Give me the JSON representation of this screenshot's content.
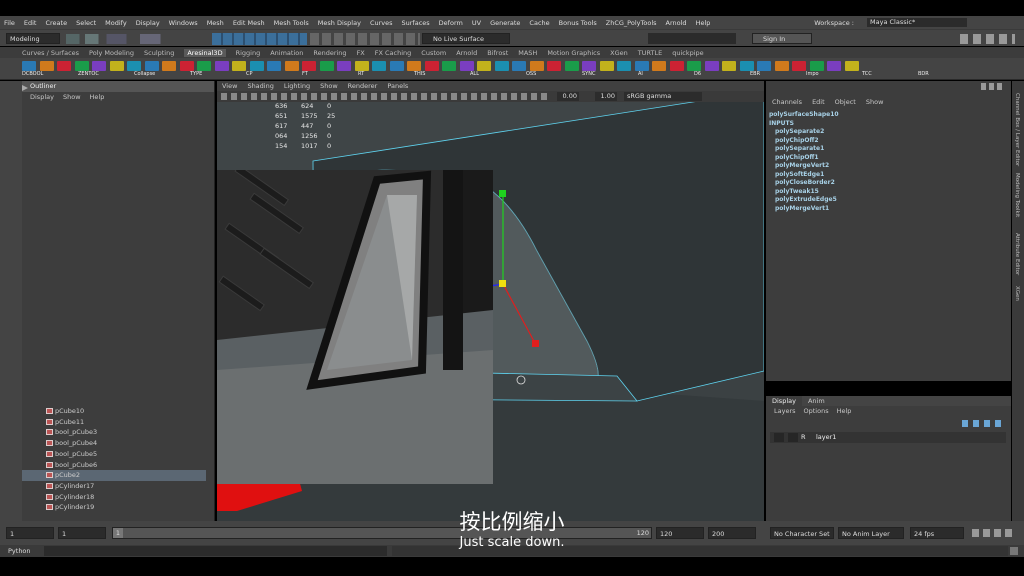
{
  "menu": [
    "File",
    "Edit",
    "Create",
    "Select",
    "Modify",
    "Display",
    "Windows",
    "Mesh",
    "Edit Mesh",
    "Mesh Tools",
    "Mesh Display",
    "Curves",
    "Surfaces",
    "Deform",
    "UV",
    "Generate",
    "Cache",
    "Bonus Tools",
    "ZhCG_PolyTools",
    "Arnold",
    "Help"
  ],
  "workspace": {
    "label": "Workspace :",
    "value": "Maya Classic*"
  },
  "mode": "Modeling",
  "live_surface": "No Live Surface",
  "sign_in": "Sign In",
  "shelf_tabs": [
    "Curves / Surfaces",
    "Poly Modeling",
    "Sculpting",
    "Aresinal3D",
    "Rigging",
    "Animation",
    "Rendering",
    "FX",
    "FX Caching",
    "Custom",
    "Arnold",
    "Bifrost",
    "MASH",
    "Motion Graphics",
    "XGen",
    "TURTLE",
    "quickpipe"
  ],
  "active_shelf": "Aresinal3D",
  "shelf_labels": [
    "DCBOOL",
    "ZENTOC",
    "Collapse",
    "TYPE",
    "CP",
    "FT",
    "RT",
    "THIS",
    "ALL",
    "OSS",
    "SYNC",
    "AI",
    "D6",
    "EBR",
    "Impo",
    "TCC",
    "BDR"
  ],
  "outliner": {
    "title": "Outliner",
    "menu": [
      "Display",
      "Show",
      "Help"
    ],
    "items": [
      "pCube10",
      "pCube11",
      "bool_pCube3",
      "bool_pCube4",
      "bool_pCube5",
      "bool_pCube6",
      "pCube2",
      "pCylinder17",
      "pCylinder18",
      "pCylinder19"
    ],
    "selected_index": 6
  },
  "viewport": {
    "menu": [
      "View",
      "Shading",
      "Lighting",
      "Show",
      "Renderer",
      "Panels"
    ],
    "exposure": "0.00",
    "gamma": "1.00",
    "color_space": "sRGB gamma",
    "stats": [
      [
        "636",
        "624",
        "0"
      ],
      [
        "651",
        "1575",
        "25"
      ],
      [
        "617",
        "447",
        "0"
      ],
      [
        "064",
        "1256",
        "0"
      ],
      [
        "154",
        "1017",
        "0"
      ]
    ]
  },
  "channel_box": {
    "menu": [
      "Channels",
      "Edit",
      "Object",
      "Show"
    ],
    "shape": "polySurfaceShape10",
    "inputs_label": "INPUTS",
    "inputs": [
      "polySeparate2",
      "polyChipOff2",
      "polySeparate1",
      "polyChipOff1",
      "polyMergeVert2",
      "polySoftEdge1",
      "polyCloseBorder2",
      "polyTweak15",
      "polyExtrudeEdge5",
      "polyMergeVert1"
    ]
  },
  "side_tabs": [
    "Channel Box / Layer Editor",
    "Modeling Toolkit",
    "Attribute Editor",
    "XGen"
  ],
  "layers": {
    "tabs": [
      "Display",
      "Anim"
    ],
    "menu": [
      "Layers",
      "Options",
      "Help"
    ],
    "layer_flag": "R",
    "layer_name": "layer1"
  },
  "timeline": {
    "start": "1",
    "current": "1",
    "frame_box": "1",
    "range_end": "120",
    "end": "120",
    "anim_end": "200",
    "character_set": "No Character Set",
    "anim_layer": "No Anim Layer",
    "fps": "24 fps"
  },
  "cmd_label": "Python",
  "subtitle": {
    "cn": "按比例缩小",
    "en": "Just scale down."
  },
  "colors": {
    "accent": "#5b6773",
    "selection_wire": "#5fd4f0",
    "bg": "#444444"
  }
}
